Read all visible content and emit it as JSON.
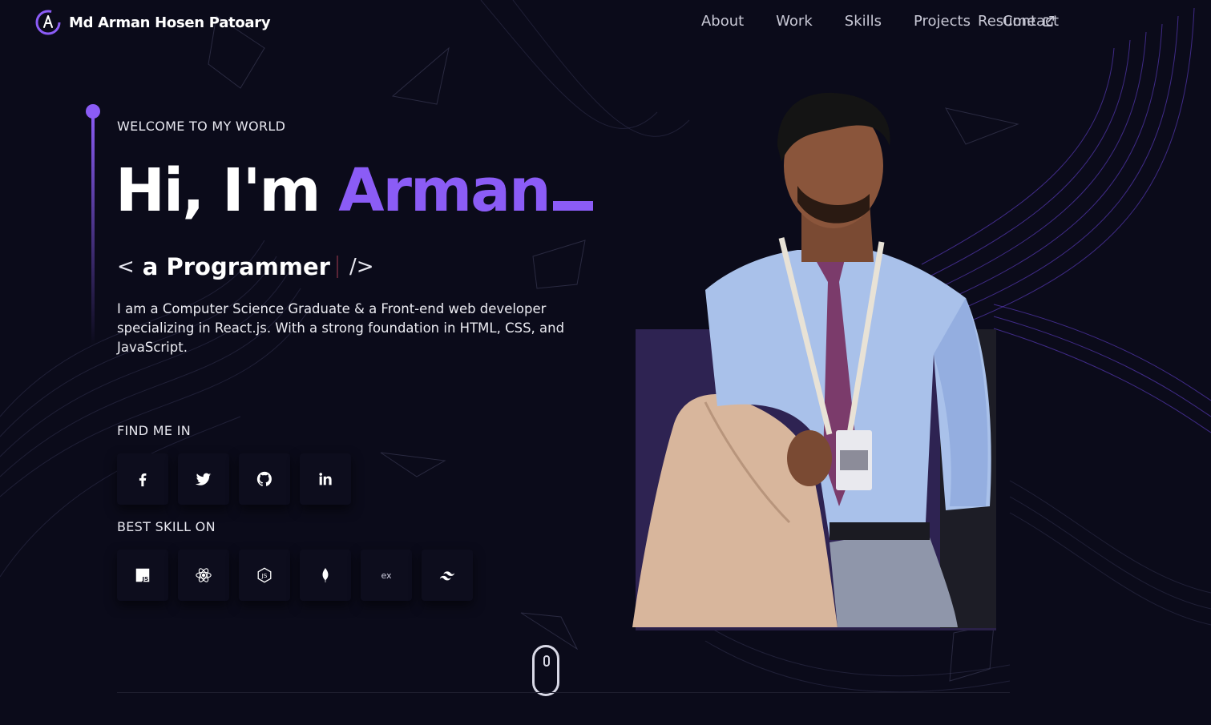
{
  "header": {
    "brand_name": "Md Arman Hosen Patoary",
    "logo_icon": "atom-logo-icon",
    "nav": [
      {
        "label": "About"
      },
      {
        "label": "Work"
      },
      {
        "label": "Skills"
      },
      {
        "label": "Projects"
      },
      {
        "label": "Contact"
      }
    ],
    "resume_label": "Resume",
    "resume_icon": "external-link-icon"
  },
  "intro": {
    "welcome": "WELCOME TO MY WORLD",
    "greeting": "Hi, I'm",
    "name": "Arman",
    "role_open": "<",
    "role": "a Programmer",
    "role_close": "/>",
    "description": "I am a Computer Science Graduate & a Front-end web developer specializing in React.js. With a strong foundation in HTML, CSS, and JavaScript."
  },
  "social": {
    "label": "FIND ME IN",
    "items": [
      {
        "name": "facebook-icon"
      },
      {
        "name": "twitter-icon"
      },
      {
        "name": "github-icon"
      },
      {
        "name": "linkedin-icon"
      }
    ]
  },
  "skills": {
    "label": "BEST SKILL ON",
    "items": [
      {
        "name": "javascript-icon",
        "text": "JS"
      },
      {
        "name": "react-icon"
      },
      {
        "name": "nodejs-icon",
        "text": "JS"
      },
      {
        "name": "mongodb-icon"
      },
      {
        "name": "express-icon",
        "text": "ex"
      },
      {
        "name": "tailwind-icon"
      }
    ]
  },
  "colors": {
    "background": "#0b0b1a",
    "accent": "#8b5cf6",
    "text": "#ffffff",
    "nav_text": "#c9c9d6"
  }
}
